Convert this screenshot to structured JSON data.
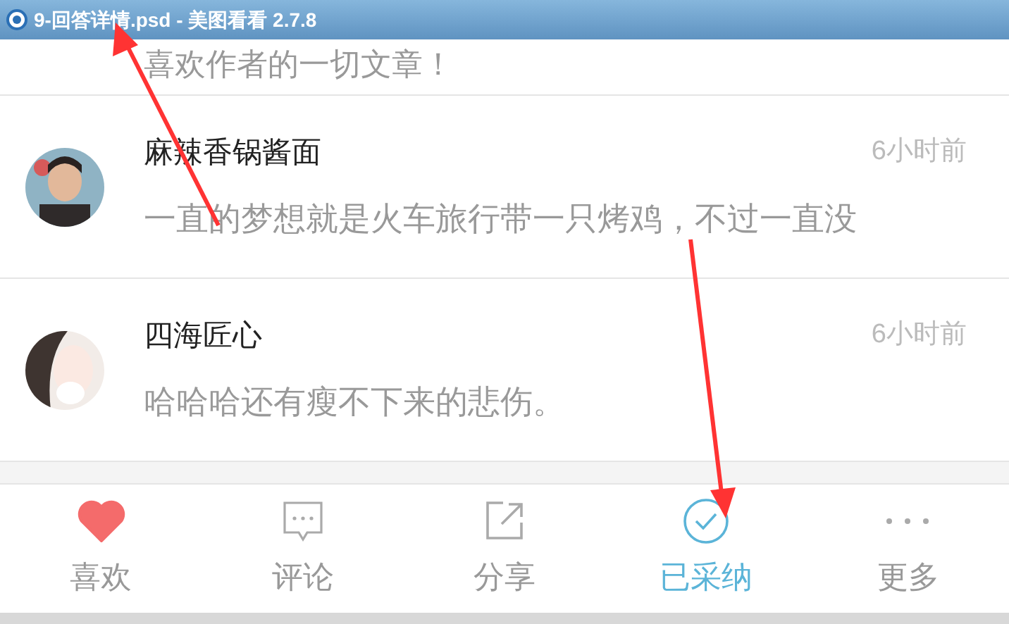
{
  "window": {
    "title": "9-回答详情.psd - 美图看看 2.7.8"
  },
  "comments": [
    {
      "text": "喜欢作者的一切文章！"
    },
    {
      "name": "麻辣香锅酱面",
      "text": "一直的梦想就是火车旅行带一只烤鸡，不过一直没",
      "time": "6小时前"
    },
    {
      "name": "四海匠心",
      "text": "哈哈哈还有瘦不下来的悲伤。",
      "time": "6小时前"
    }
  ],
  "tabs": [
    {
      "label": "喜欢",
      "kind": "heart",
      "on": true,
      "selected": false
    },
    {
      "label": "评论",
      "kind": "comment",
      "on": false,
      "selected": false
    },
    {
      "label": "分享",
      "kind": "share",
      "on": false,
      "selected": false
    },
    {
      "label": "已采纳",
      "kind": "check",
      "on": false,
      "selected": true
    },
    {
      "label": "更多",
      "kind": "more",
      "on": false,
      "selected": false
    }
  ]
}
